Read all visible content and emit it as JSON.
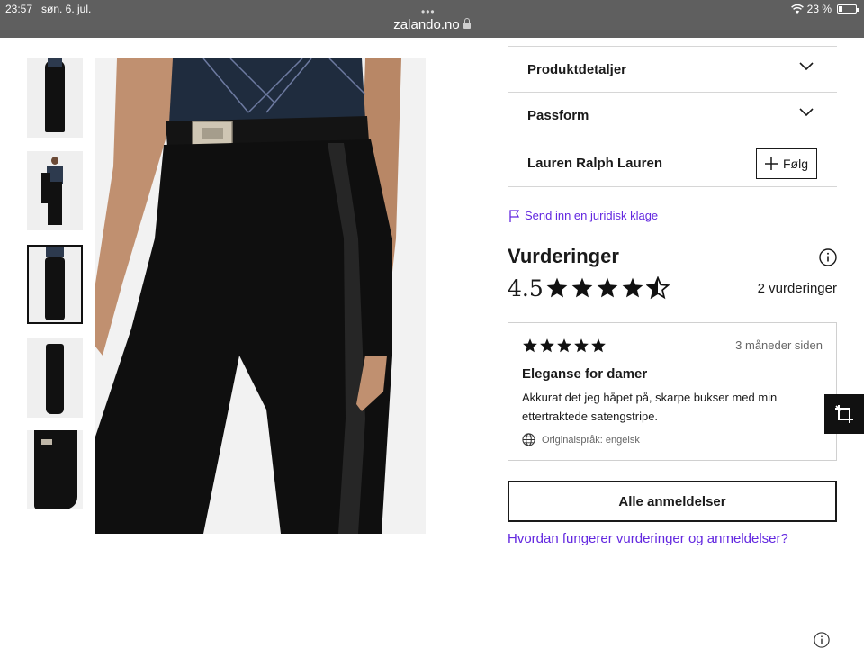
{
  "status": {
    "time": "23:57",
    "date": "søn. 6. jul.",
    "battery_text": "23 %",
    "battery_level": 0.23
  },
  "browser": {
    "url": "zalando.no"
  },
  "gallery": {
    "thumbnails": [
      "thumb-1",
      "thumb-2",
      "thumb-3",
      "thumb-4",
      "thumb-5"
    ],
    "selected_index": 2
  },
  "accordion": {
    "product_details": "Produktdetaljer",
    "fit": "Passform"
  },
  "brand": {
    "name": "Lauren Ralph Lauren",
    "follow_label": "Følg"
  },
  "legal": {
    "link_label": "Send inn en juridisk klage"
  },
  "ratings": {
    "title": "Vurderinger",
    "score": "4.5",
    "stars": 4.5,
    "count_label": "2 vurderinger"
  },
  "review": {
    "stars": 5,
    "time": "3 måneder siden",
    "title": "Eleganse for damer",
    "body": "Akkurat det jeg håpet på, skarpe bukser med min ettertraktede satengstripe.",
    "language": "Originalspråk: engelsk"
  },
  "actions": {
    "all_reviews": "Alle anmeldelser",
    "how_link": "Hvordan fungerer vurderinger og anmeldelser?"
  },
  "colors": {
    "accent_link": "#6328e0",
    "status_bar": "#5f5f5f",
    "text": "#1a1a1a"
  }
}
